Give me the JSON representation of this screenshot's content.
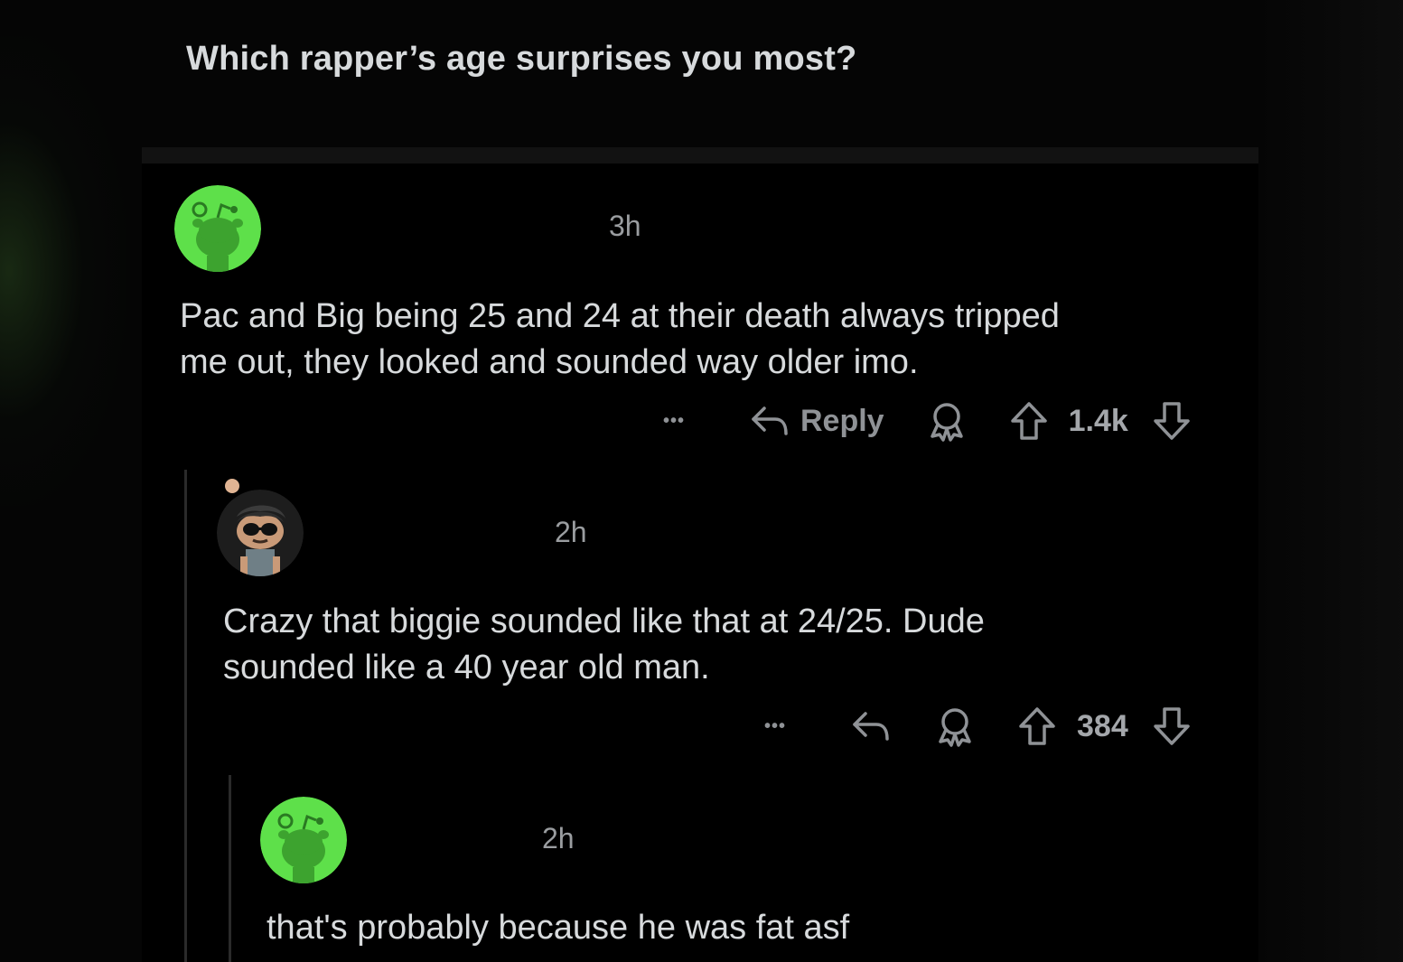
{
  "post": {
    "title": "Which rapper’s age surprises you most?"
  },
  "comments": [
    {
      "avatar": "snoo-green-avatar",
      "time": "3h",
      "text_line1": "Pac and Big being 25 and 24 at their death always tripped",
      "text_line2": "me out, they looked and sounded way older imo.",
      "more_label": "•••",
      "reply_label": "Reply",
      "score": "1.4k"
    },
    {
      "avatar": "custom-sunglasses-avatar",
      "time": "2h",
      "text_line1": "Crazy that biggie sounded like that at 24/25. Dude",
      "text_line2": "sounded like a 40 year old man.",
      "more_label": "•••",
      "score": "384"
    },
    {
      "avatar": "snoo-green-avatar",
      "time": "2h",
      "text_line1": "that's probably because he was fat asf"
    }
  ],
  "colors": {
    "background": "#000000",
    "text": "#d7dadc",
    "muted": "#8f9296",
    "avatar_green": "#5ee04a"
  }
}
